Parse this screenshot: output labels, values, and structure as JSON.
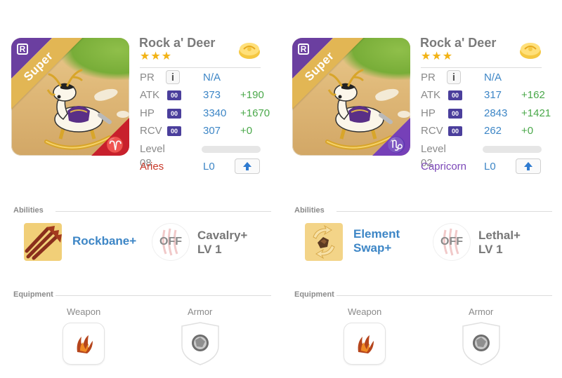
{
  "cards": [
    {
      "rarity_badge": "R",
      "ribbon": "Super",
      "name": "Rock a' Deer",
      "stars": "★★★",
      "pr": {
        "label": "PR",
        "value": "N/A"
      },
      "atk": {
        "label": "ATK",
        "tag": "00",
        "value": "373",
        "bonus": "+190"
      },
      "hp": {
        "label": "HP",
        "tag": "00",
        "value": "3340",
        "bonus": "+1670"
      },
      "rcv": {
        "label": "RCV",
        "tag": "00",
        "value": "307",
        "bonus": "+0"
      },
      "level": {
        "label": "Level 08",
        "progress": 0
      },
      "zodiac": {
        "name": "Aries",
        "limit": "L0",
        "glyph": "♈",
        "color": "#c93a2b"
      },
      "abilities_title": "Abilities",
      "ability": {
        "name": "Rockbane+",
        "icon": "triple-arrows-icon"
      },
      "passive": {
        "off": "OFF",
        "name": "Cavalry+",
        "level": "LV 1"
      },
      "equipment_title": "Equipment",
      "weapon_label": "Weapon",
      "armor_label": "Armor"
    },
    {
      "rarity_badge": "R",
      "ribbon": "Super",
      "name": "Rock a' Deer",
      "stars": "★★★",
      "pr": {
        "label": "PR",
        "value": "N/A"
      },
      "atk": {
        "label": "ATK",
        "tag": "00",
        "value": "317",
        "bonus": "+162"
      },
      "hp": {
        "label": "HP",
        "tag": "00",
        "value": "2843",
        "bonus": "+1421"
      },
      "rcv": {
        "label": "RCV",
        "tag": "00",
        "value": "262",
        "bonus": "+0"
      },
      "level": {
        "label": "Level 02",
        "progress": 0
      },
      "zodiac": {
        "name": "Capricorn",
        "limit": "L0",
        "glyph": "♑",
        "color": "#7c48b8"
      },
      "abilities_title": "Abilities",
      "ability": {
        "name_line1": "Element",
        "name_line2": "Swap+",
        "icon": "element-swap-icon"
      },
      "passive": {
        "off": "OFF",
        "name": "Lethal+",
        "level": "LV 1"
      },
      "equipment_title": "Equipment",
      "weapon_label": "Weapon",
      "armor_label": "Armor"
    }
  ]
}
